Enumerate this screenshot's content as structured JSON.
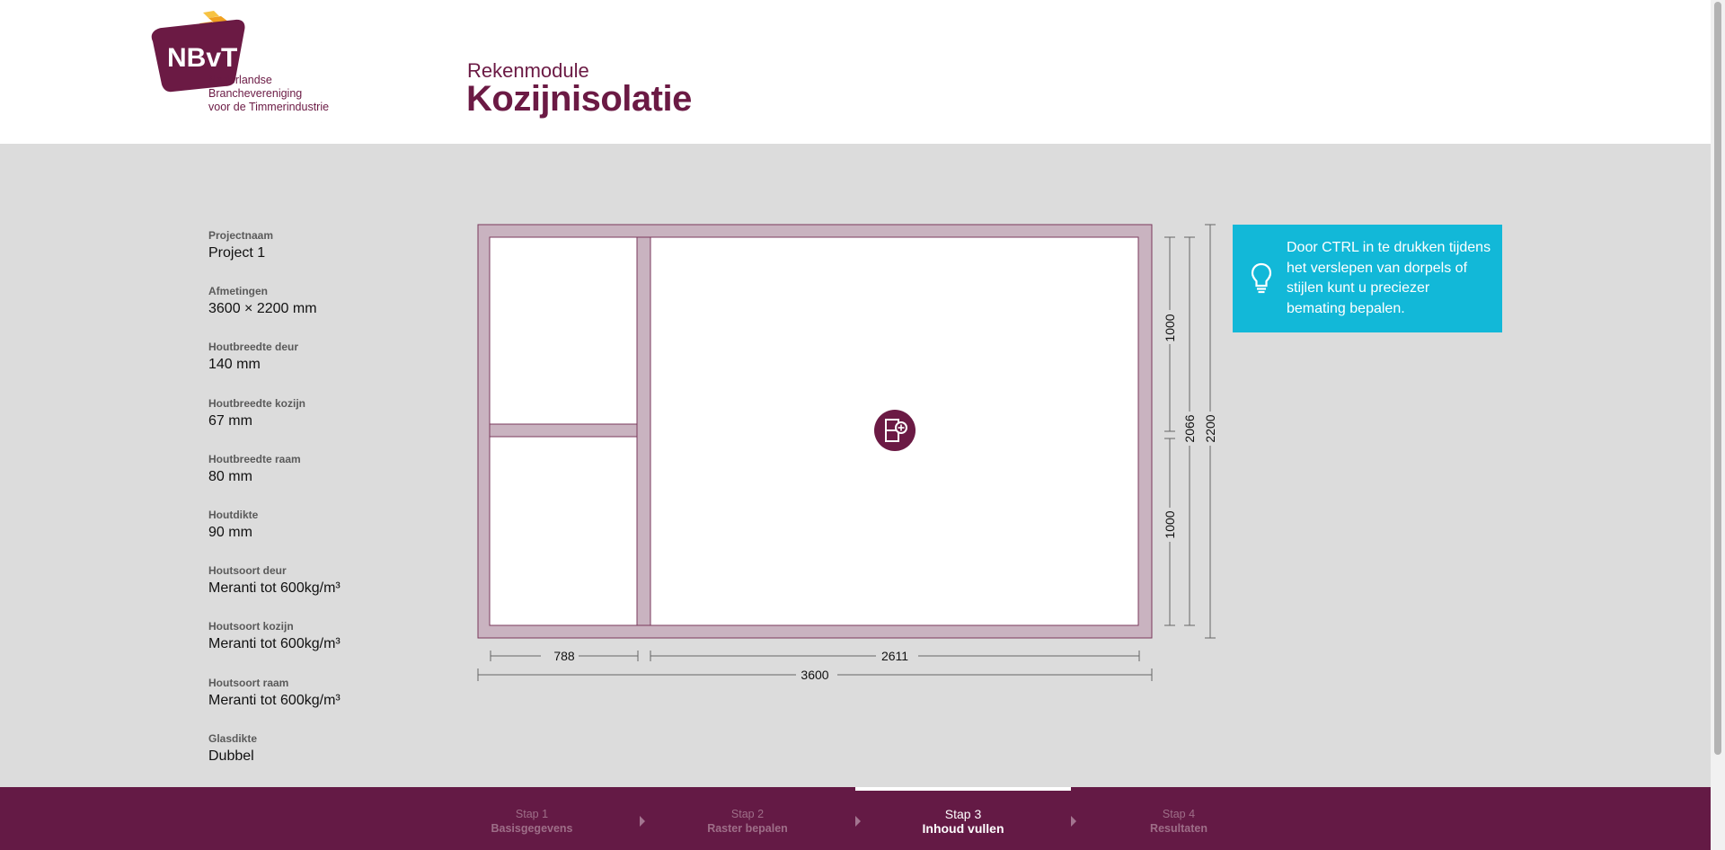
{
  "logo": {
    "brand": "NBvT",
    "lines": [
      "Nederlandse",
      "Branchevereniging",
      "voor de Timmerindustrie"
    ]
  },
  "header": {
    "subtitle": "Rekenmodule",
    "title": "Kozijnisolatie"
  },
  "summary": [
    {
      "label": "Projectnaam",
      "value": "Project 1"
    },
    {
      "label": "Afmetingen",
      "value": "3600 × 2200 mm"
    },
    {
      "label": "Houtbreedte deur",
      "value": "140 mm"
    },
    {
      "label": "Houtbreedte kozijn",
      "value": "67 mm"
    },
    {
      "label": "Houtbreedte raam",
      "value": "80 mm"
    },
    {
      "label": "Houtdikte",
      "value": "90 mm"
    },
    {
      "label": "Houtsoort deur",
      "value": "Meranti tot 600kg/m³"
    },
    {
      "label": "Houtsoort kozijn",
      "value": "Meranti tot 600kg/m³"
    },
    {
      "label": "Houtsoort raam",
      "value": "Meranti tot 600kg/m³"
    },
    {
      "label": "Glasdikte",
      "value": "Dubbel"
    }
  ],
  "drawing": {
    "dimensions": {
      "left_width": "788",
      "right_width": "2611",
      "total_width": "3600",
      "top_height": "1000",
      "bottom_height": "1000",
      "inner_height": "2066",
      "total_height": "2200"
    },
    "add_icon": "add-panel-icon"
  },
  "tip": {
    "icon": "lightbulb-icon",
    "text": "Door CTRL in te drukken tijdens het verslepen van dorpels of stijlen kunt u preciezer bemating bepalen."
  },
  "steps": [
    {
      "num": "Stap 1",
      "name": "Basisgegevens",
      "active": false
    },
    {
      "num": "Stap 2",
      "name": "Raster bepalen",
      "active": false
    },
    {
      "num": "Stap 3",
      "name": "Inhoud vullen",
      "active": true
    },
    {
      "num": "Stap 4",
      "name": "Resultaten",
      "active": false
    }
  ],
  "colors": {
    "brand": "#6b1a44",
    "footer": "#641a45",
    "frame": "#c9b3c0",
    "tip": "#12b8d8",
    "logo_orange": "#f0a020",
    "logo_yellow": "#f7c343"
  }
}
